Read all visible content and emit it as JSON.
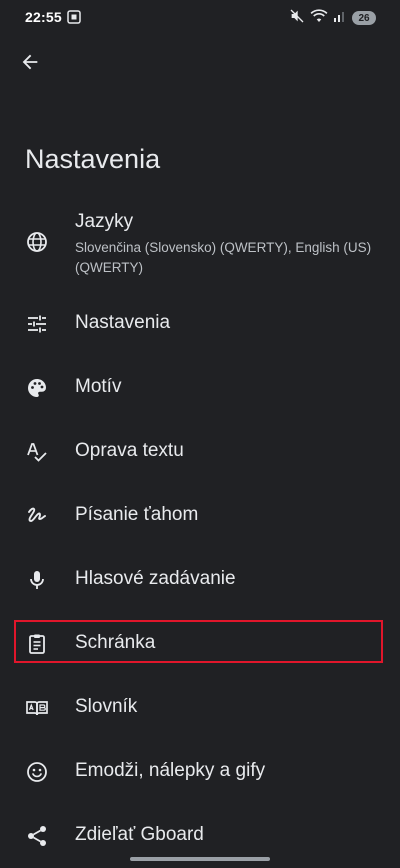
{
  "status_bar": {
    "time": "22:55",
    "battery": "26"
  },
  "header": {
    "title": "Nastavenia"
  },
  "settings": {
    "items": [
      {
        "title": "Jazyky",
        "subtitle": "Slovenčina (Slovensko) (QWERTY), English (US) (QWERTY)",
        "icon": "globe-icon"
      },
      {
        "title": "Nastavenia",
        "icon": "tune-icon"
      },
      {
        "title": "Motív",
        "icon": "palette-icon"
      },
      {
        "title": "Oprava textu",
        "icon": "spellcheck-icon"
      },
      {
        "title": "Písanie ťahom",
        "icon": "gesture-icon"
      },
      {
        "title": "Hlasové zadávanie",
        "icon": "mic-icon"
      },
      {
        "title": "Schránka",
        "icon": "clipboard-icon"
      },
      {
        "title": "Slovník",
        "icon": "book-icon"
      },
      {
        "title": "Emodži, nálepky a gify",
        "icon": "emoji-icon"
      },
      {
        "title": "Zdieľať Gboard",
        "icon": "share-icon"
      }
    ]
  },
  "colors": {
    "background": "#202124",
    "text_primary": "#e8eaed",
    "text_secondary": "#bdc1c6",
    "highlight": "#e0162b"
  }
}
